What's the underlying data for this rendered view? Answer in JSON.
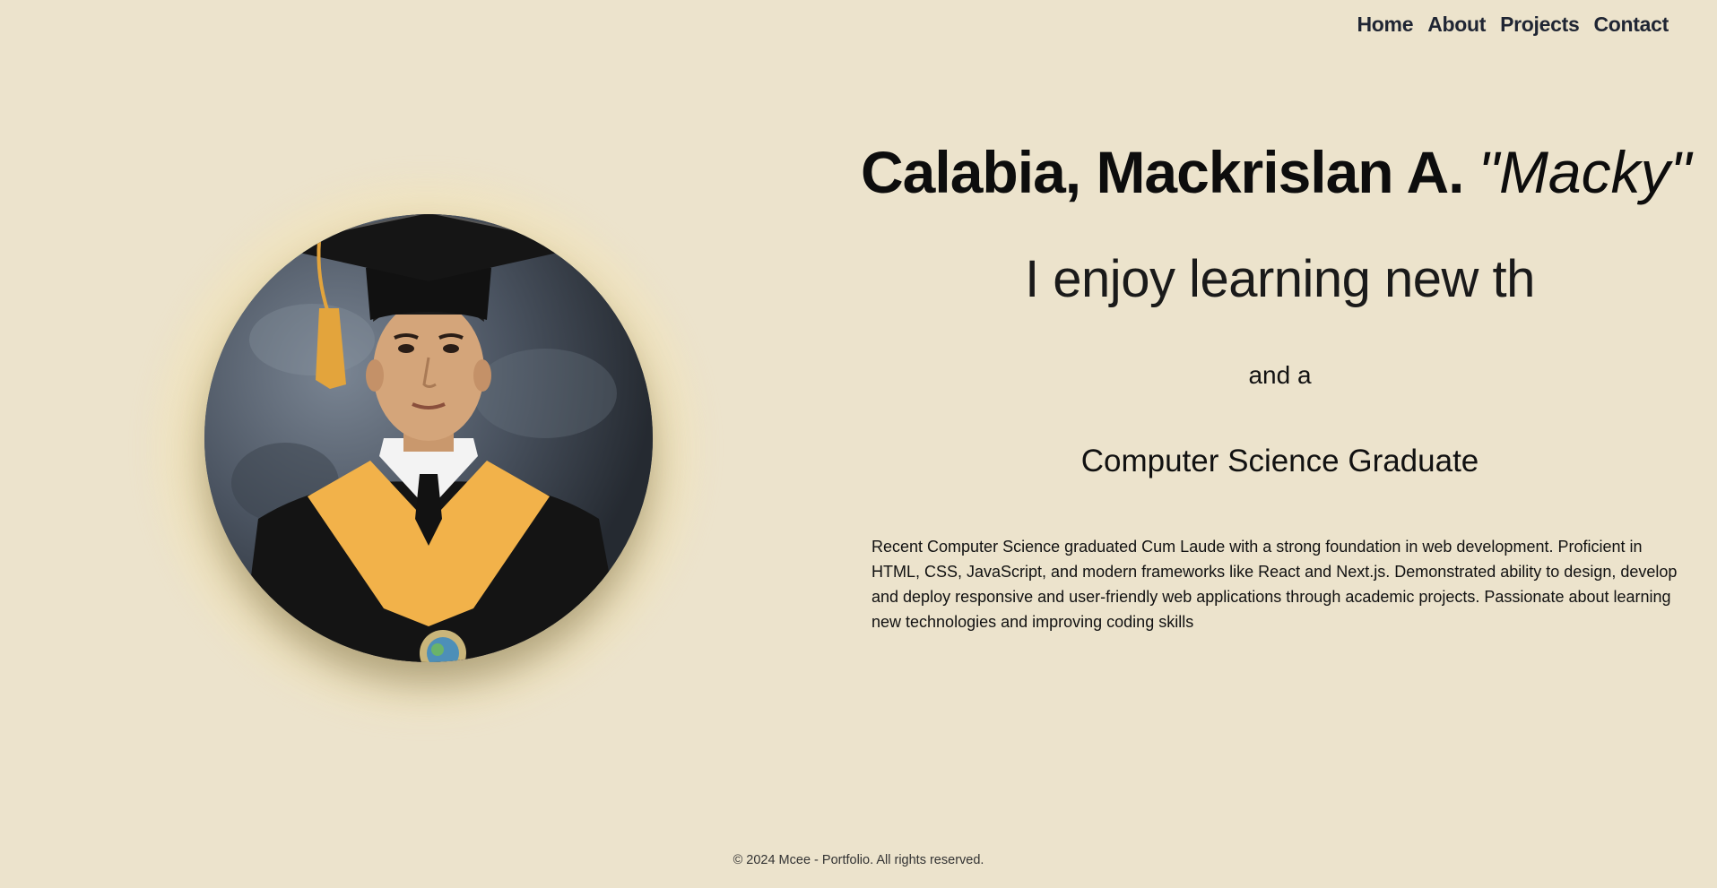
{
  "nav": {
    "items": [
      {
        "label": "Home"
      },
      {
        "label": "About"
      },
      {
        "label": "Projects"
      },
      {
        "label": "Contact"
      }
    ]
  },
  "hero": {
    "name": "Calabia, Mackrislan A.",
    "nickname": "\"Macky\"",
    "tagline": "I enjoy learning new th",
    "connector": "and a",
    "role": "Computer Science Graduate",
    "bio": "Recent Computer Science graduated Cum Laude with a strong foundation in web development. Proficient in HTML, CSS, JavaScript, and modern frameworks like React and Next.js. Demonstrated ability to design, develop and deploy responsive and user-friendly web applications through academic projects. Passionate about learning new technologies and improving coding skills"
  },
  "footer": {
    "text": "© 2024 Mcee - Portfolio. All rights reserved."
  },
  "colors": {
    "background": "#ece3cc",
    "nav_text": "#1f2533",
    "glow": "#f8e2a0"
  }
}
